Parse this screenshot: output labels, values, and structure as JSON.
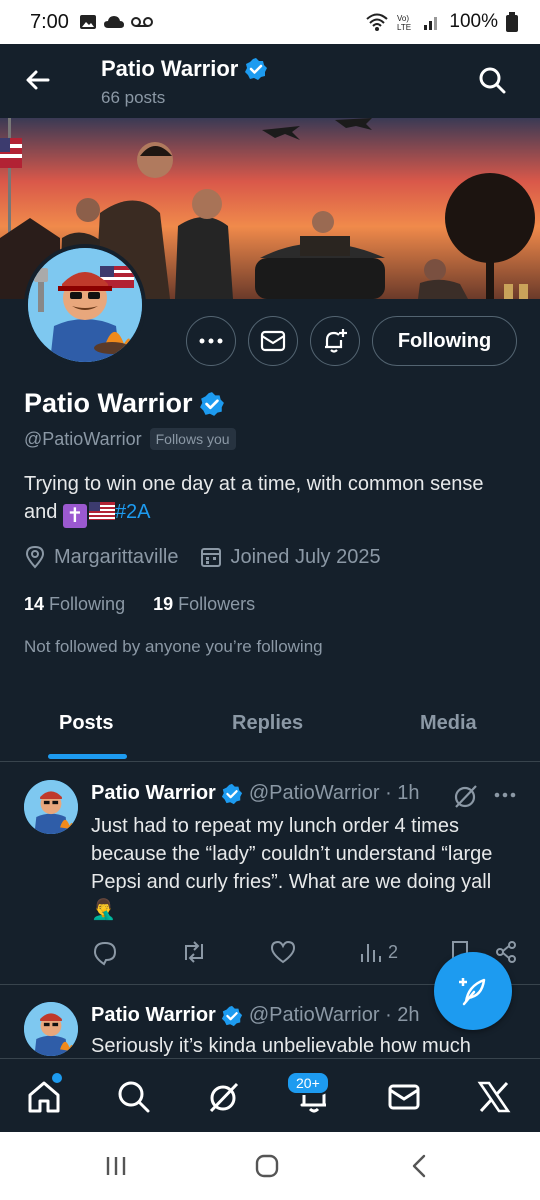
{
  "status_bar": {
    "time": "7:00",
    "battery": "100%",
    "icons": [
      "image-icon",
      "cloud-icon",
      "voicemail-icon",
      "wifi-icon",
      "volte-icon",
      "signal-icon",
      "battery-icon"
    ]
  },
  "header": {
    "title": "Patio Warrior",
    "posts_count": "66 posts"
  },
  "profile": {
    "name": "Patio Warrior",
    "handle": "@PatioWarrior",
    "follows_you": "Follows you",
    "following_button": "Following",
    "bio_text": "Trying to win one day at a time, with common sense and ",
    "bio_cross": "✝",
    "bio_hashtag": "#2A",
    "location": "Margarittaville",
    "joined": "Joined July 2025",
    "following_count": "14",
    "following_label": "Following",
    "followers_count": "19",
    "followers_label": "Followers",
    "not_followed": "Not followed by anyone you’re following"
  },
  "tabs": [
    {
      "label": "Posts",
      "active": true
    },
    {
      "label": "Replies",
      "active": false
    },
    {
      "label": "Media",
      "active": false
    }
  ],
  "posts": [
    {
      "name": "Patio Warrior",
      "handle_time": "@PatioWarrior · 1h",
      "text": "Just had to repeat my lunch order 4 times because the “lady” couldn’t understand “large Pepsi and curly fries”. What are we doing yall 🤦‍♂️",
      "views": "2"
    },
    {
      "name": "Patio Warrior",
      "handle_time": "@PatioWarrior · 2h",
      "text": "Seriously it’s kinda unbelievable how much"
    }
  ],
  "bottom_nav": {
    "notifications_badge": "20+",
    "items": [
      "home-icon",
      "search-icon",
      "grok-icon",
      "notifications-icon",
      "messages-icon",
      "x-logo-icon"
    ]
  },
  "colors": {
    "background": "#15202b",
    "accent": "#1d9bf0",
    "muted": "#8b98a5",
    "divider": "#38444d"
  }
}
